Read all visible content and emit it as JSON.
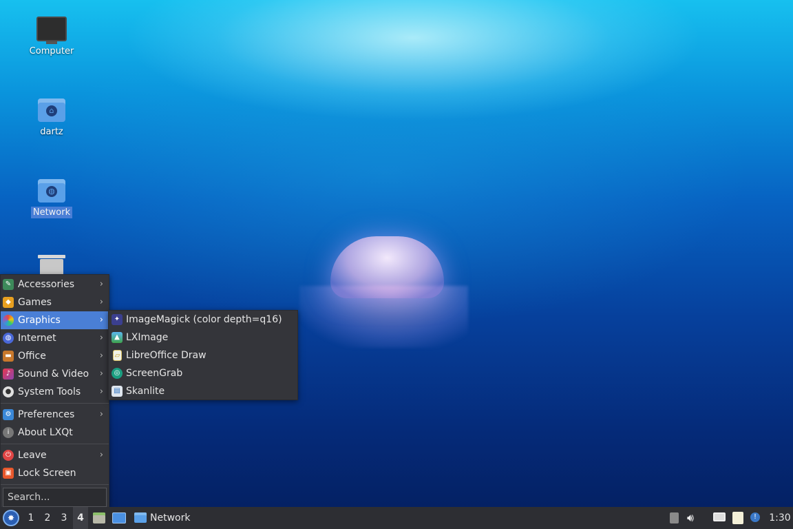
{
  "desktop": {
    "icons": [
      {
        "name": "Computer",
        "selected": false
      },
      {
        "name": "dartz",
        "selected": false
      },
      {
        "name": "Network",
        "selected": true
      },
      {
        "name": "Trash",
        "selected": false
      }
    ]
  },
  "main_menu": {
    "items": [
      {
        "label": "Accessories",
        "icon": "accessories-icon",
        "submenu": true
      },
      {
        "label": "Games",
        "icon": "games-icon",
        "submenu": true
      },
      {
        "label": "Graphics",
        "icon": "graphics-icon",
        "submenu": true,
        "active": true
      },
      {
        "label": "Internet",
        "icon": "internet-icon",
        "submenu": true
      },
      {
        "label": "Office",
        "icon": "office-icon",
        "submenu": true
      },
      {
        "label": "Sound & Video",
        "icon": "sound-video-icon",
        "submenu": true
      },
      {
        "label": "System Tools",
        "icon": "system-tools-icon",
        "submenu": true
      },
      {
        "label": "Preferences",
        "icon": "preferences-icon",
        "submenu": true
      },
      {
        "label": "About LXQt",
        "icon": "info-icon",
        "submenu": false
      },
      {
        "label": "Leave",
        "icon": "power-icon",
        "submenu": true
      },
      {
        "label": "Lock Screen",
        "icon": "lock-icon",
        "submenu": false
      }
    ],
    "search_placeholder": "Search..."
  },
  "graphics_submenu": {
    "items": [
      {
        "label": "ImageMagick (color depth=q16)",
        "icon": "imagemagick-icon"
      },
      {
        "label": "LXImage",
        "icon": "lximage-icon"
      },
      {
        "label": "LibreOffice Draw",
        "icon": "libreoffice-draw-icon"
      },
      {
        "label": "ScreenGrab",
        "icon": "screengrab-icon"
      },
      {
        "label": "Skanlite",
        "icon": "skanlite-icon"
      }
    ]
  },
  "taskbar": {
    "workspaces": [
      "1",
      "2",
      "3",
      "4"
    ],
    "current_workspace": "4",
    "task_label": "Network",
    "clock": "1:30"
  },
  "colors": {
    "menu_bg": "#34353a",
    "highlight": "#4a7fd6",
    "taskbar_bg": "#2d2e33"
  }
}
